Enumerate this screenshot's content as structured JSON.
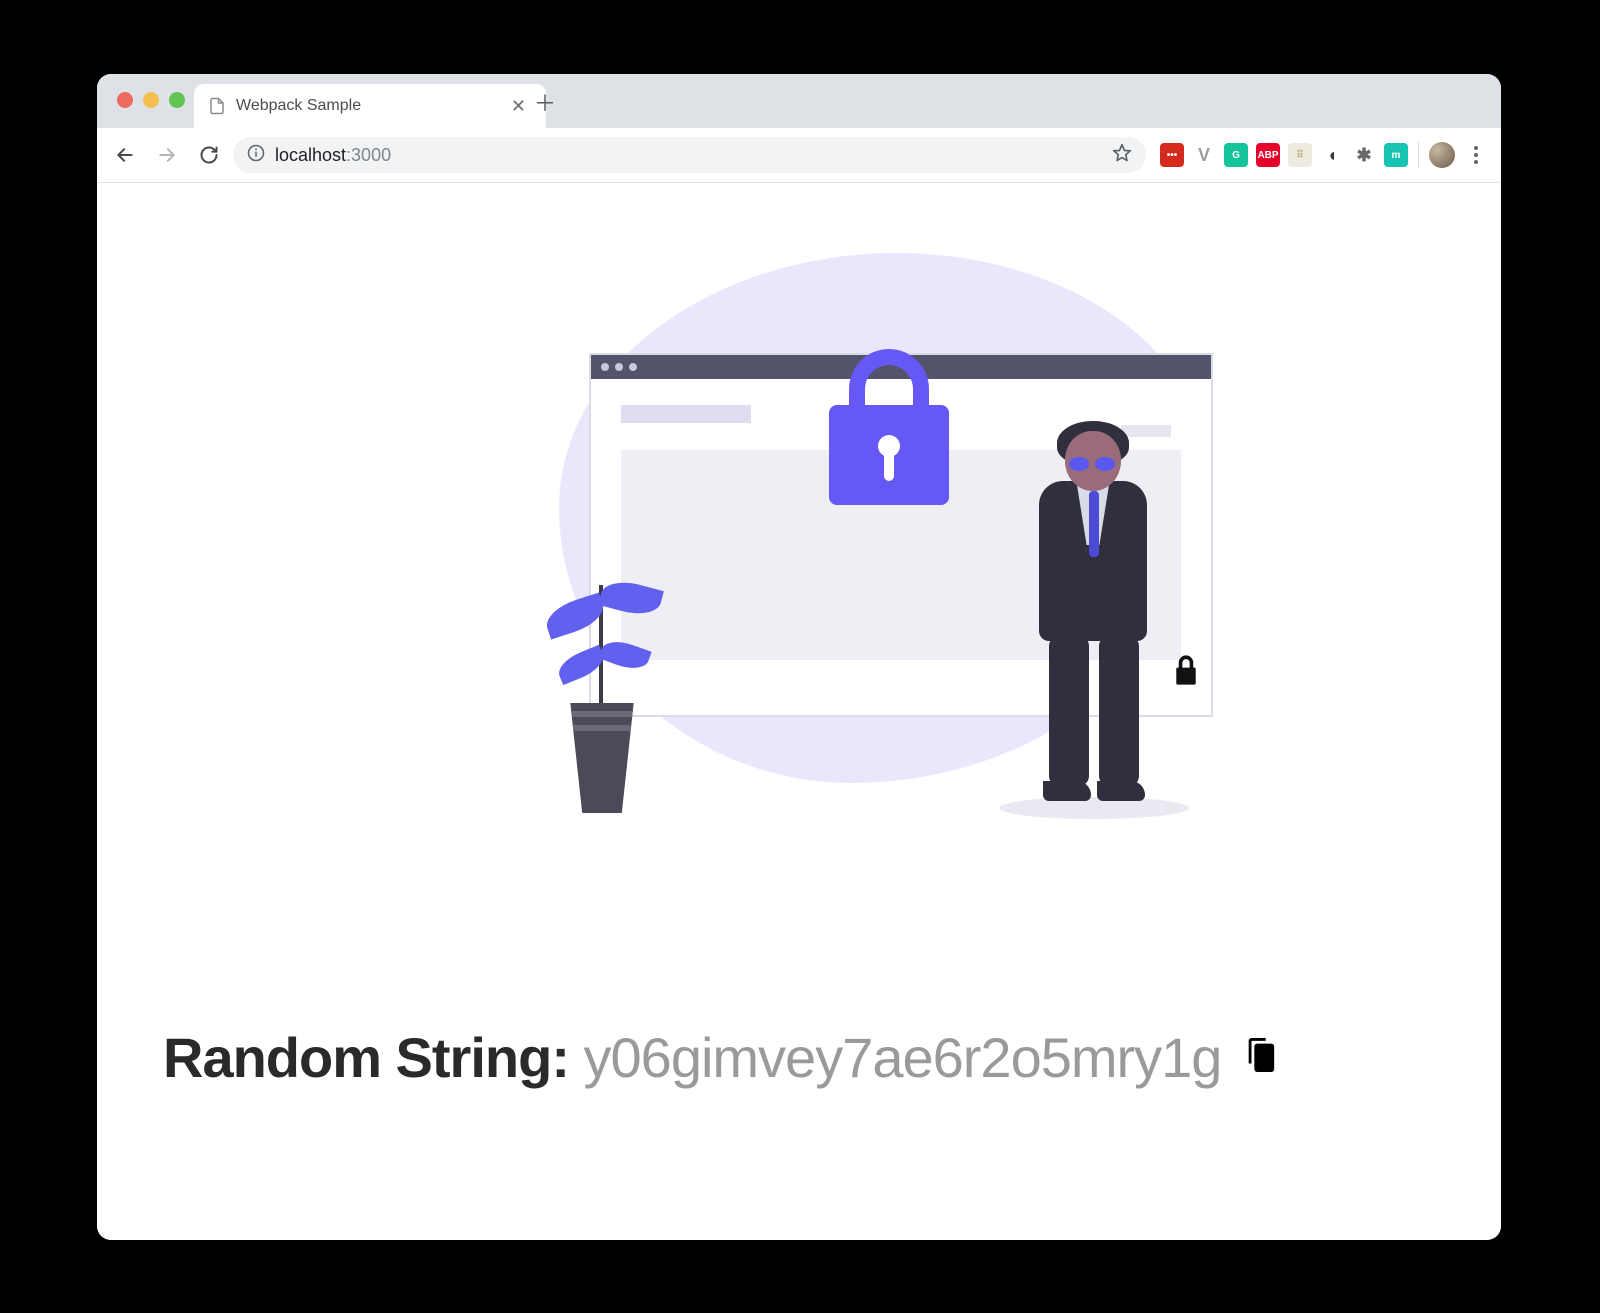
{
  "browser": {
    "tab": {
      "title": "Webpack Sample"
    },
    "address": {
      "host": "localhost",
      "rest": ":3000"
    },
    "extensions": [
      {
        "name": "lastpass",
        "glyph": "•••",
        "bg": "#d52b1e"
      },
      {
        "name": "vue",
        "glyph": "V",
        "bg": "transparent",
        "fg": "#9e9e9e"
      },
      {
        "name": "grammarly",
        "glyph": "G",
        "bg": "#15c39a"
      },
      {
        "name": "adblock",
        "glyph": "ABP",
        "bg": "#e4002b"
      },
      {
        "name": "extension-grid",
        "glyph": "⠿",
        "bg": "#efeadf",
        "fg": "#b8a97a"
      },
      {
        "name": "dark-mode",
        "glyph": "◖",
        "bg": "transparent",
        "fg": "#3a3a3a"
      },
      {
        "name": "extension-cog",
        "glyph": "✱",
        "bg": "transparent",
        "fg": "#6a6a6a"
      },
      {
        "name": "extension-m",
        "glyph": "m",
        "bg": "#17c3b2"
      }
    ]
  },
  "page": {
    "result_label": "Random String: ",
    "result_value": "y06gimvey7ae6r2o5mry1g"
  }
}
